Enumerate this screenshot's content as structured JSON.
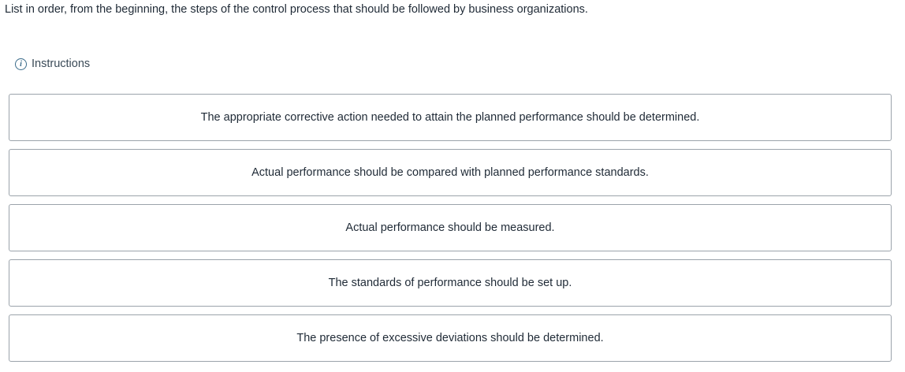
{
  "question": {
    "prompt": "List in order, from the beginning, the steps of the control process that should be followed by business organizations."
  },
  "instructions": {
    "icon": "info-icon",
    "label": "Instructions"
  },
  "steps": [
    {
      "text": "The appropriate corrective action needed to attain the planned performance should be determined."
    },
    {
      "text": "Actual performance should be compared with planned performance standards."
    },
    {
      "text": "Actual performance should be measured."
    },
    {
      "text": "The standards of performance should be set up."
    },
    {
      "text": "The presence of excessive deviations should be determined."
    }
  ],
  "colors": {
    "border": "#9ba3ab",
    "text": "#1f2a36",
    "icon": "#3a6b8a"
  }
}
